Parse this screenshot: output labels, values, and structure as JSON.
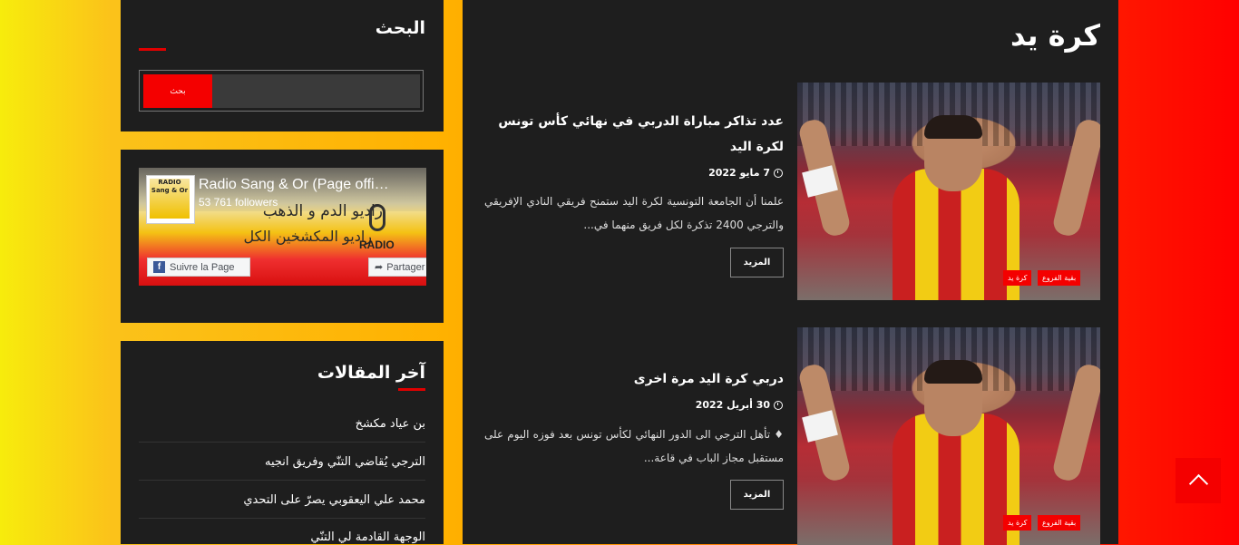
{
  "search_widget": {
    "title": "البحث",
    "input_placeholder": "",
    "button_label": "بحث"
  },
  "facebook_widget": {
    "page_name": "Radio Sang & Or (Page offi…",
    "followers": "53 761 followers",
    "cover_line1": "راديو الدم و الذهب",
    "cover_line2": "راديو المكشخين الكل",
    "cover_brand": "RADIO",
    "logo_text": "RADIO Sang & Or",
    "like_button": "Suivre la Page",
    "share_button": "Partager"
  },
  "recent_widget": {
    "title": "آخر المقالات",
    "items": [
      "بن عياد مكشخ",
      "الترجي يُقاضي التنّي وفريق انجيه",
      "محمد علي اليعقوبي يصرّ على التحدي",
      "الوجهة القادمة لي التنّي"
    ]
  },
  "main": {
    "section_title": "كرة يد",
    "posts": [
      {
        "title": "عدد تذاكر مباراة الدربي في نهائي كأس تونس لكرة اليد",
        "date": "7 مايو 2022",
        "excerpt": "علمنا أن الجامعة التونسية لكرة اليد ستمنح فريقي النادي الإفريقي والترجي 2400 تذكرة لكل فريق منهما في...",
        "more_label": "المزيد",
        "tags": [
          "بقية الفروع",
          "كرة يد"
        ]
      },
      {
        "title": "دربي كرة اليد مرة اخرى",
        "date": "30 أبريل 2022",
        "excerpt": "♦ تأهل الترجي الى الدور النهائي لكأس تونس بعد فوزه اليوم على مستقبل مجاز الباب في قاعة...",
        "more_label": "المزيد",
        "tags": [
          "بقية الفروع",
          "كرة يد"
        ]
      }
    ]
  },
  "colors": {
    "accent": "#f40000",
    "panel": "#1e1e1e"
  },
  "icons": {
    "clock": "clock-icon",
    "back_to_top": "chevron-up-icon"
  }
}
